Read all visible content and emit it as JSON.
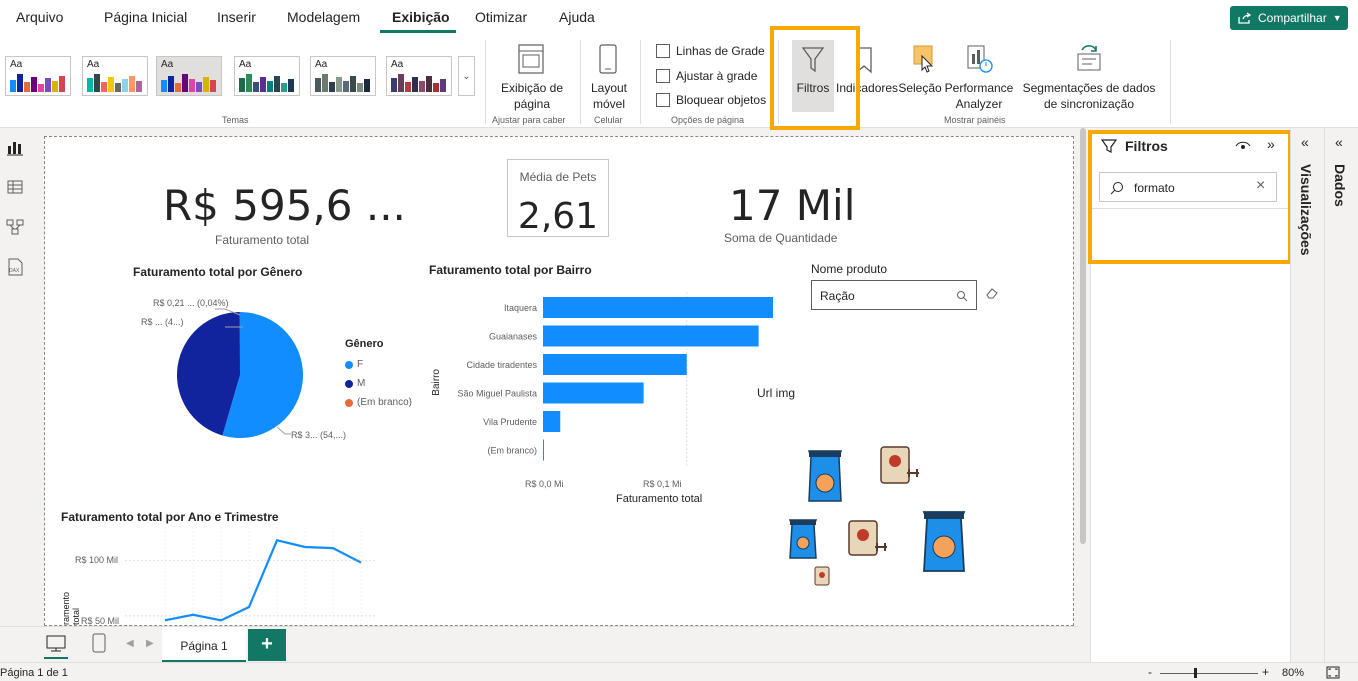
{
  "menu": {
    "items": [
      "Arquivo",
      "Página Inicial",
      "Inserir",
      "Modelagem",
      "Exibição",
      "Otimizar",
      "Ajuda"
    ],
    "share_label": "Compartilhar"
  },
  "ribbon": {
    "themes_label": "Temas",
    "page_view_label": "Exibição de página",
    "fit_label": "Ajustar para caber",
    "mobile_layout_label": "Layout móvel",
    "mobile_group_label": "Celular",
    "gridlines_label": "Linhas de Grade",
    "snap_label": "Ajustar à grade",
    "lock_label": "Bloquear objetos",
    "page_options_label": "Opções de página",
    "filters_label": "Filtros",
    "bookmarks_label": "Indicadores",
    "selection_label": "Seleção",
    "performance_label": "Performance Analyzer",
    "sync_label": "Segmentações de dados de sincronização",
    "show_panes_label": "Mostrar painéis",
    "theme_aa": "Aa"
  },
  "canvas": {
    "card1": {
      "value": "R$ 595,6 ...",
      "label": "Faturamento total"
    },
    "card2": {
      "label": "Média de Pets",
      "value": "2,61"
    },
    "card3": {
      "value": "17 Mil",
      "label": "Soma de Quantidade"
    },
    "pie": {
      "title": "Faturamento total por Gênero",
      "label_top": "R$ 0,21 ... (0,04%)",
      "label_mid": "R$ ... (4...)",
      "label_bottom": "R$ 3... (54,...)",
      "legend_title": "Gênero",
      "legend": [
        {
          "name": "F",
          "color": "#118dff"
        },
        {
          "name": "M",
          "color": "#12239e"
        },
        {
          "name": "(Em branco)",
          "color": "#e66c37"
        }
      ]
    },
    "bar": {
      "title": "Faturamento total por Bairro",
      "ylabel": "Bairro",
      "xlabel": "Faturamento total",
      "x_ticks": [
        "R$ 0,0 Mi",
        "R$ 0,1 Mi"
      ]
    },
    "slicer": {
      "title": "Nome produto",
      "value": "Ração"
    },
    "url_img_label": "Url img",
    "line": {
      "title": "Faturamento total por Ano e Trimestre",
      "ylabel": "ramento total",
      "y_ticks": [
        "R$ 100 Mil",
        "R$ 50 Mil"
      ]
    }
  },
  "chart_data": [
    {
      "type": "pie",
      "title": "Faturamento total por Gênero",
      "categories": [
        "F",
        "M",
        "(Em branco)"
      ],
      "values": [
        54.5,
        45.46,
        0.04
      ],
      "colors": [
        "#118dff",
        "#12239e",
        "#e66c37"
      ]
    },
    {
      "type": "bar",
      "title": "Faturamento total por Bairro",
      "categories": [
        "Itaquera",
        "Guaianases",
        "Cidade tiradentes",
        "São Miguel Paulista",
        "Vila Prudente",
        "(Em branco)"
      ],
      "values": [
        0.16,
        0.15,
        0.1,
        0.07,
        0.012,
        0.0005
      ],
      "xlim": [
        0,
        0.16
      ],
      "xlabel": "Faturamento total",
      "ylabel": "Bairro",
      "color": "#118dff"
    },
    {
      "type": "line",
      "title": "Faturamento total por Ano e Trimestre",
      "x": [
        1,
        2,
        3,
        4,
        5,
        6,
        7,
        8,
        9
      ],
      "values": [
        46,
        51,
        46,
        58,
        118,
        112,
        111,
        98,
        120
      ],
      "ylim": [
        40,
        130
      ],
      "color": "#118dff"
    }
  ],
  "filters_pane": {
    "title": "Filtros",
    "search_value": "formato"
  },
  "visualizations_label": "Visualizações",
  "data_label": "Dados",
  "page_tab": {
    "label": "Página 1"
  },
  "status": {
    "page_info": "Página 1 de 1",
    "zoom": "80%"
  }
}
